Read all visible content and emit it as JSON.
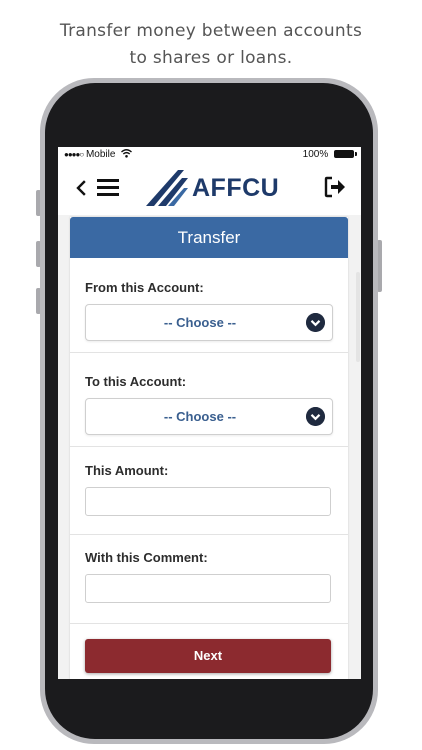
{
  "caption": {
    "line1": "Transfer money between accounts",
    "line2": "to shares or loans."
  },
  "status_bar": {
    "signal": "●●●●○",
    "carrier": "Mobile",
    "battery": "100%"
  },
  "app_bar": {
    "logo_text": "AFFCU",
    "icons": [
      "chevron-left-icon",
      "hamburger-menu-icon",
      "logout-icon"
    ]
  },
  "transfer_form": {
    "title": "Transfer",
    "from_label": "From this Account:",
    "from_selected": "-- Choose --",
    "to_label": "To this Account:",
    "to_selected": "-- Choose --",
    "amount_label": "This Amount:",
    "amount_value": "",
    "comment_label": "With this Comment:",
    "comment_value": "",
    "next_label": "Next"
  },
  "colors": {
    "header_blue": "#3a69a3",
    "logo_navy": "#1e3a6a",
    "next_button": "#8c2a2f",
    "select_text": "#3a5f8f"
  }
}
